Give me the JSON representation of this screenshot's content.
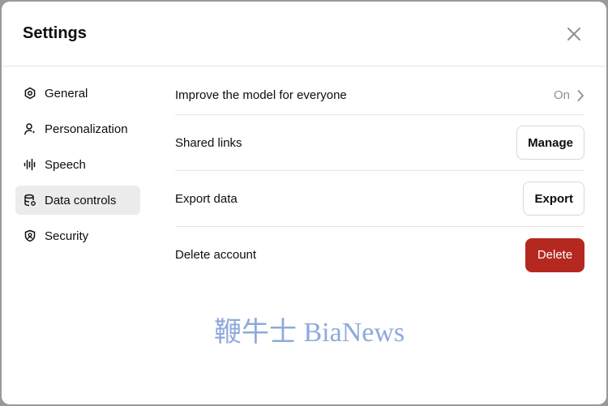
{
  "header": {
    "title": "Settings"
  },
  "sidebar": {
    "items": [
      {
        "label": "General",
        "icon": "gear-icon",
        "active": false
      },
      {
        "label": "Personalization",
        "icon": "person-icon",
        "active": false
      },
      {
        "label": "Speech",
        "icon": "waveform-icon",
        "active": false
      },
      {
        "label": "Data controls",
        "icon": "database-icon",
        "active": true
      },
      {
        "label": "Security",
        "icon": "shield-user-icon",
        "active": false
      }
    ]
  },
  "data_controls": {
    "improve_model": {
      "label": "Improve the model for everyone",
      "value": "On"
    },
    "shared_links": {
      "label": "Shared links",
      "button": "Manage"
    },
    "export_data": {
      "label": "Export data",
      "button": "Export"
    },
    "delete_account": {
      "label": "Delete account",
      "button": "Delete"
    }
  },
  "watermark": {
    "text": "鞭牛士 BiaNews"
  },
  "colors": {
    "danger": "#b5281f",
    "active_nav_bg": "#ececec",
    "watermark": "#8fa9dc"
  }
}
